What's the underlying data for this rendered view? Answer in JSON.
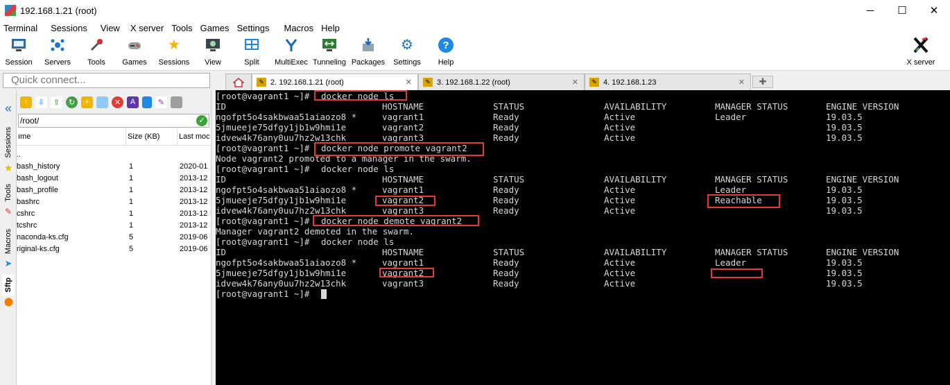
{
  "window": {
    "title": "192.168.1.21 (root)",
    "minimize": "─",
    "maximize": "☐",
    "close": "✕"
  },
  "menu": [
    "Terminal",
    "Sessions",
    "View",
    "X server",
    "Tools",
    "Games",
    "Settings",
    "Macros",
    "Help"
  ],
  "toolbar": [
    {
      "label": "Session",
      "icon": "session-icon"
    },
    {
      "label": "Servers",
      "icon": "servers-icon"
    },
    {
      "label": "Tools",
      "icon": "tools-icon"
    },
    {
      "label": "Games",
      "icon": "games-icon"
    },
    {
      "label": "Sessions",
      "icon": "sessions-star-icon"
    },
    {
      "label": "View",
      "icon": "view-icon"
    },
    {
      "label": "Split",
      "icon": "split-icon"
    },
    {
      "label": "MultiExec",
      "icon": "multiexec-icon"
    },
    {
      "label": "Tunneling",
      "icon": "tunneling-icon"
    },
    {
      "label": "Packages",
      "icon": "packages-icon"
    },
    {
      "label": "Settings",
      "icon": "settings-icon"
    },
    {
      "label": "Help",
      "icon": "help-icon"
    }
  ],
  "xserver_label": "X server",
  "quick_connect_placeholder": "Quick connect...",
  "side_tabs": [
    "Sessions",
    "Tools",
    "Macros",
    "Sftp"
  ],
  "sftp": {
    "path": "/root/",
    "columns": [
      "ıme",
      "Size (KB)",
      "Last moc"
    ],
    "files": [
      {
        "name": "..",
        "size": "",
        "date": ""
      },
      {
        "name": "bash_history",
        "size": "1",
        "date": "2020-01"
      },
      {
        "name": "bash_logout",
        "size": "1",
        "date": "2013-12"
      },
      {
        "name": "bash_profile",
        "size": "1",
        "date": "2013-12"
      },
      {
        "name": "bashrc",
        "size": "1",
        "date": "2013-12"
      },
      {
        "name": "cshrc",
        "size": "1",
        "date": "2013-12"
      },
      {
        "name": "tcshrc",
        "size": "1",
        "date": "2013-12"
      },
      {
        "name": "naconda-ks.cfg",
        "size": "5",
        "date": "2019-06"
      },
      {
        "name": "riginal-ks.cfg",
        "size": "5",
        "date": "2019-06"
      }
    ]
  },
  "tabs": [
    {
      "label": "2. 192.168.1.21 (root)",
      "active": true
    },
    {
      "label": "3. 192.168.1.22 (root)",
      "active": false
    },
    {
      "label": "4. 192.168.1.23",
      "active": false
    }
  ],
  "terminal": {
    "prompt": "[root@vagrant1 ~]#",
    "cmd1": "docker node ls",
    "cmd2": "docker node promote vagrant2",
    "cmd3": "docker node ls",
    "cmd4": "docker node demote vagrant2",
    "cmd5": "docker node ls",
    "headers": [
      "ID",
      "HOSTNAME",
      "STATUS",
      "AVAILABILITY",
      "MANAGER STATUS",
      "ENGINE VERSION"
    ],
    "table1": [
      [
        "ngofpt5o4sakbwaa51aiaozo8 *",
        "vagrant1",
        "Ready",
        "Active",
        "Leader",
        "19.03.5"
      ],
      [
        "5jmueeje75dfgy1jb1w9hmi1e",
        "vagrant2",
        "Ready",
        "Active",
        "",
        "19.03.5"
      ],
      [
        "idvew4k76any0uu7hz2w13chk",
        "vagrant3",
        "Ready",
        "Active",
        "",
        "19.03.5"
      ]
    ],
    "msg_promote": "Node vagrant2 promoted to a manager in the swarm.",
    "table2": [
      [
        "ngofpt5o4sakbwaa51aiaozo8 *",
        "vagrant1",
        "Ready",
        "Active",
        "Leader",
        "19.03.5"
      ],
      [
        "5jmueeje75dfgy1jb1w9hmi1e",
        "vagrant2",
        "Ready",
        "Active",
        "Reachable",
        "19.03.5"
      ],
      [
        "idvew4k76any0uu7hz2w13chk",
        "vagrant3",
        "Ready",
        "Active",
        "",
        "19.03.5"
      ]
    ],
    "msg_demote": "Manager vagrant2 demoted in the swarm.",
    "table3": [
      [
        "ngofpt5o4sakbwaa51aiaozo8 *",
        "vagrant1",
        "Ready",
        "Active",
        "Leader",
        "19.03.5"
      ],
      [
        "5jmueeje75dfgy1jb1w9hmi1e",
        "vagrant2",
        "Ready",
        "Active",
        "",
        "19.03.5"
      ],
      [
        "idvew4k76any0uu7hz2w13chk",
        "vagrant3",
        "Ready",
        "Active",
        "",
        "19.03.5"
      ]
    ]
  },
  "colors": {
    "highlight": "#e53935",
    "terminal_bg": "#000000",
    "terminal_fg": "#d8d8d8"
  }
}
